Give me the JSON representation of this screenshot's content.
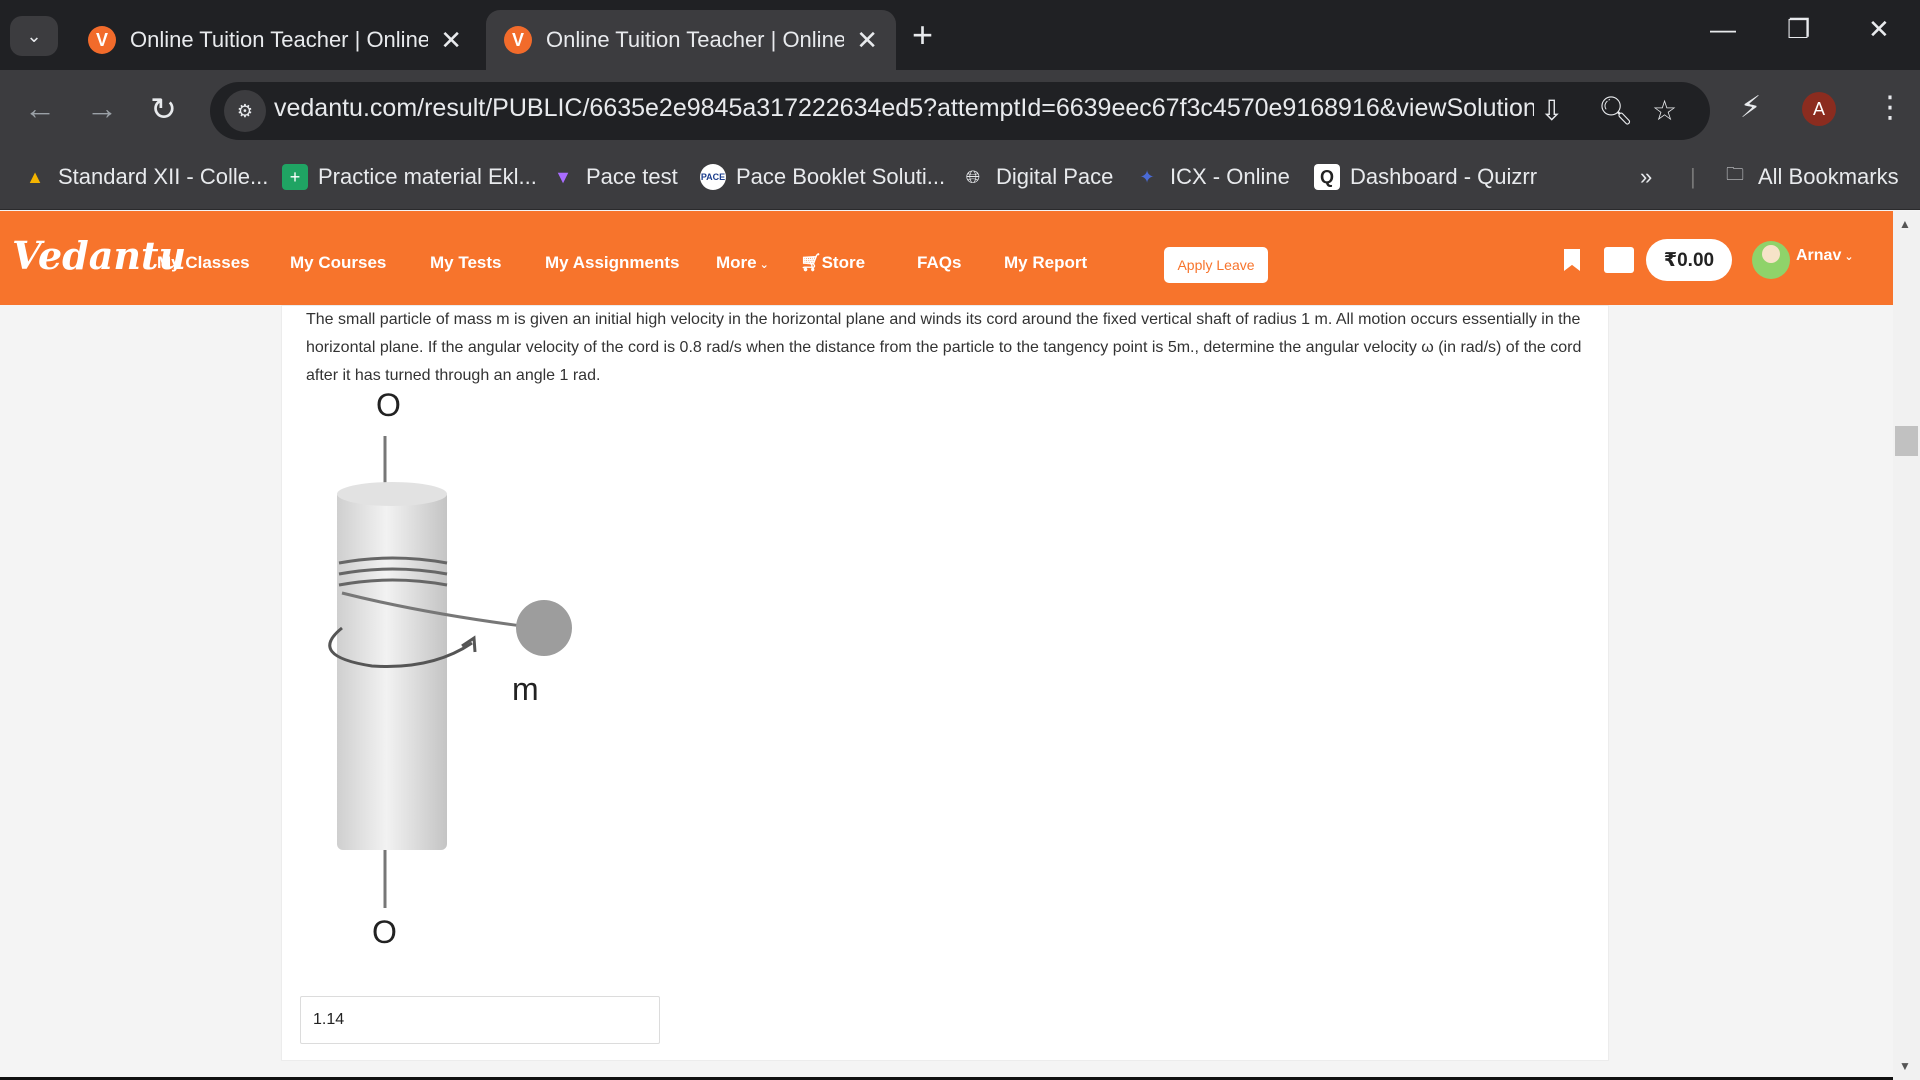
{
  "browser": {
    "tabs": [
      {
        "title": "Online Tuition Teacher | Online",
        "favicon": "V",
        "active": false
      },
      {
        "title": "Online Tuition Teacher | Online",
        "favicon": "V",
        "active": true
      }
    ],
    "url": "vedantu.com/result/PUBLIC/6635e2e9845a317222634ed5?attemptId=6639eec67f3c4570e9168916&viewSolution=...",
    "profile_initial": "A",
    "bookmarks": [
      {
        "label": "Standard XII - Colle...",
        "icon": "drive-icon"
      },
      {
        "label": "Practice material Ekl...",
        "icon": "plus-icon"
      },
      {
        "label": "Pace test",
        "icon": "vite-icon"
      },
      {
        "label": "Pace Booklet Soluti...",
        "icon": "pace-icon"
      },
      {
        "label": "Digital Pace",
        "icon": "globe-icon"
      },
      {
        "label": "ICX - Online",
        "icon": "icx-icon"
      },
      {
        "label": "Dashboard - Quizrr",
        "icon": "quizrr-icon"
      }
    ],
    "all_bookmarks": "All Bookmarks"
  },
  "site": {
    "logo": "Vedantu",
    "nav": [
      "My Classes",
      "My Courses",
      "My Tests",
      "My Assignments",
      "More",
      "Store",
      "FAQs",
      "My Report"
    ],
    "apply_leave": "Apply Leave",
    "balance": "₹0.00",
    "user": "Arnav",
    "brand_color": "#f7742c"
  },
  "question": {
    "text": "The small particle of mass m is given an initial high velocity in the horizontal plane and winds its cord around the fixed vertical shaft of radius 1 m. All motion occurs essentially in the horizontal plane. If the angular velocity of the cord is 0.8 rad/s when the distance from the particle to the tangency point is 5m., determine the angular velocity ω (in rad/s) of the cord after it has turned through an angle 1 rad.",
    "figure_labels": {
      "top": "O",
      "bottom": "O",
      "mass": "m"
    },
    "answer": "1.14"
  }
}
